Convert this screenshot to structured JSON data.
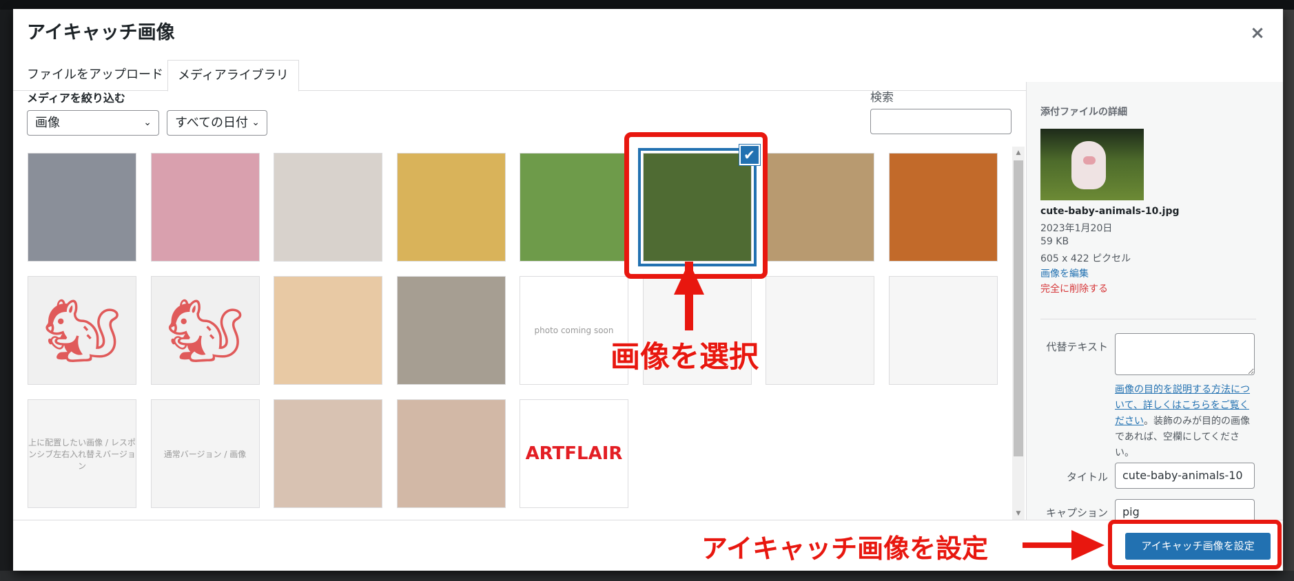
{
  "modal": {
    "title": "アイキャッチ画像",
    "close_label": "×"
  },
  "tabs": [
    {
      "label": "ファイルをアップロード",
      "active": false
    },
    {
      "label": "メディアライブラリ",
      "active": true
    }
  ],
  "filters": {
    "label": "メディアを絞り込む",
    "type_selected": "画像",
    "date_selected": "すべての日付",
    "chevron": "⌄"
  },
  "search": {
    "label": "検索",
    "value": "",
    "placeholder": ""
  },
  "attachments": [
    {
      "name": "long-tailed-tit",
      "color": "#8a8f99",
      "label": ""
    },
    {
      "name": "axolotl",
      "color": "#d9a0ae",
      "label": ""
    },
    {
      "name": "hedgehog",
      "color": "#d8d2cc",
      "label": ""
    },
    {
      "name": "quiche",
      "color": "#d9b35a",
      "label": ""
    },
    {
      "name": "salad",
      "color": "#6e9b4a",
      "label": ""
    },
    {
      "name": "cute-baby-animals-10",
      "color": "#4f6b33",
      "label": "",
      "selected": true
    },
    {
      "name": "japanese-meal",
      "color": "#b89a70",
      "label": ""
    },
    {
      "name": "red-panda",
      "color": "#c26a2a",
      "label": ""
    },
    {
      "name": "squirrel-logo-1",
      "color": "#f0f0f0",
      "label": "🐿"
    },
    {
      "name": "squirrel-logo-2",
      "color": "#f0f0f0",
      "label": "🐿"
    },
    {
      "name": "sleeping-cat-orange",
      "color": "#e8c9a4",
      "label": ""
    },
    {
      "name": "sleeping-cat-tabby",
      "color": "#a69e92",
      "label": ""
    },
    {
      "name": "photo-coming-soon",
      "color": "#ffffff",
      "label": "photo coming soon"
    },
    {
      "name": "screenshot-code-editor",
      "color": "#f6f6f6",
      "label": ""
    },
    {
      "name": "screenshot-cards",
      "color": "#f6f6f6",
      "label": ""
    },
    {
      "name": "screenshot-theme-editor",
      "color": "#f6f6f6",
      "label": ""
    },
    {
      "name": "responsive-swap-version",
      "color": "#f4f4f4",
      "label": "上に配置したい画像 / レスポンシブ左右入れ替えバージョン"
    },
    {
      "name": "normal-version",
      "color": "#f4f4f4",
      "label": "通常バージョン / 画像"
    },
    {
      "name": "kids-painting-1",
      "color": "#d8c2b2",
      "label": ""
    },
    {
      "name": "kids-painting-2",
      "color": "#d2b8a6",
      "label": ""
    },
    {
      "name": "artflair-logo",
      "color": "#ffffff",
      "label": "ARTFLAIR"
    }
  ],
  "details": {
    "heading": "添付ファイルの詳細",
    "filename": "cute-baby-animals-10.jpg",
    "date": "2023年1月20日",
    "filesize": "59 KB",
    "dimensions": "605 x 422 ピクセル",
    "edit_link": "画像を編集",
    "delete_link": "完全に削除する",
    "alt_label": "代替テキスト",
    "alt_value": "",
    "alt_help_link": "画像の目的を説明する方法について、詳しくはこちらをご覧ください",
    "alt_help_text": "。装飾のみが目的の画像であれば、空欄にしてください。",
    "title_label": "タイトル",
    "title_value": "cute-baby-animals-10",
    "caption_label": "キャプション",
    "caption_value": "pig"
  },
  "footer": {
    "primary_button": "アイキャッチ画像を設定"
  },
  "annotations": {
    "select_image": "画像を選択",
    "set_featured": "アイキャッチ画像を設定"
  },
  "colors": {
    "accent": "#2271b1",
    "danger": "#d63638",
    "annotation": "#e8170f"
  }
}
